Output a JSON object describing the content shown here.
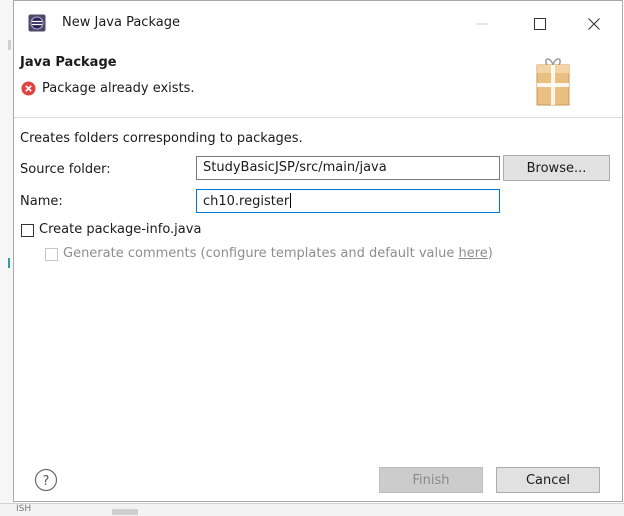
{
  "window": {
    "title": "New Java Package",
    "controls": {
      "minimize": "—",
      "maximize": "☐",
      "close": "✕"
    }
  },
  "header": {
    "title": "Java Package",
    "message": "Package already exists.",
    "message_icon": "error-icon",
    "banner_icon": "package-wizard-icon"
  },
  "form": {
    "description": "Creates folders corresponding to packages.",
    "source_folder_label": "Source folder:",
    "source_folder_value": "StudyBasicJSP/src/main/java",
    "browse_label": "Browse...",
    "name_label": "Name:",
    "name_value": "ch10.register",
    "create_package_info_label": "Create package-info.java",
    "create_package_info_checked": false,
    "generate_comments_label": "Generate comments (configure templates and default value ",
    "generate_comments_link": "here",
    "generate_comments_close": ")",
    "generate_comments_enabled": false
  },
  "footer": {
    "help_icon": "help-icon",
    "finish_label": "Finish",
    "finish_enabled": false,
    "cancel_label": "Cancel"
  },
  "background": {
    "status_text": "ISH"
  },
  "colors": {
    "error": "#e0443e",
    "focus_border": "#0078d7",
    "package_icon": "#e0b574"
  }
}
